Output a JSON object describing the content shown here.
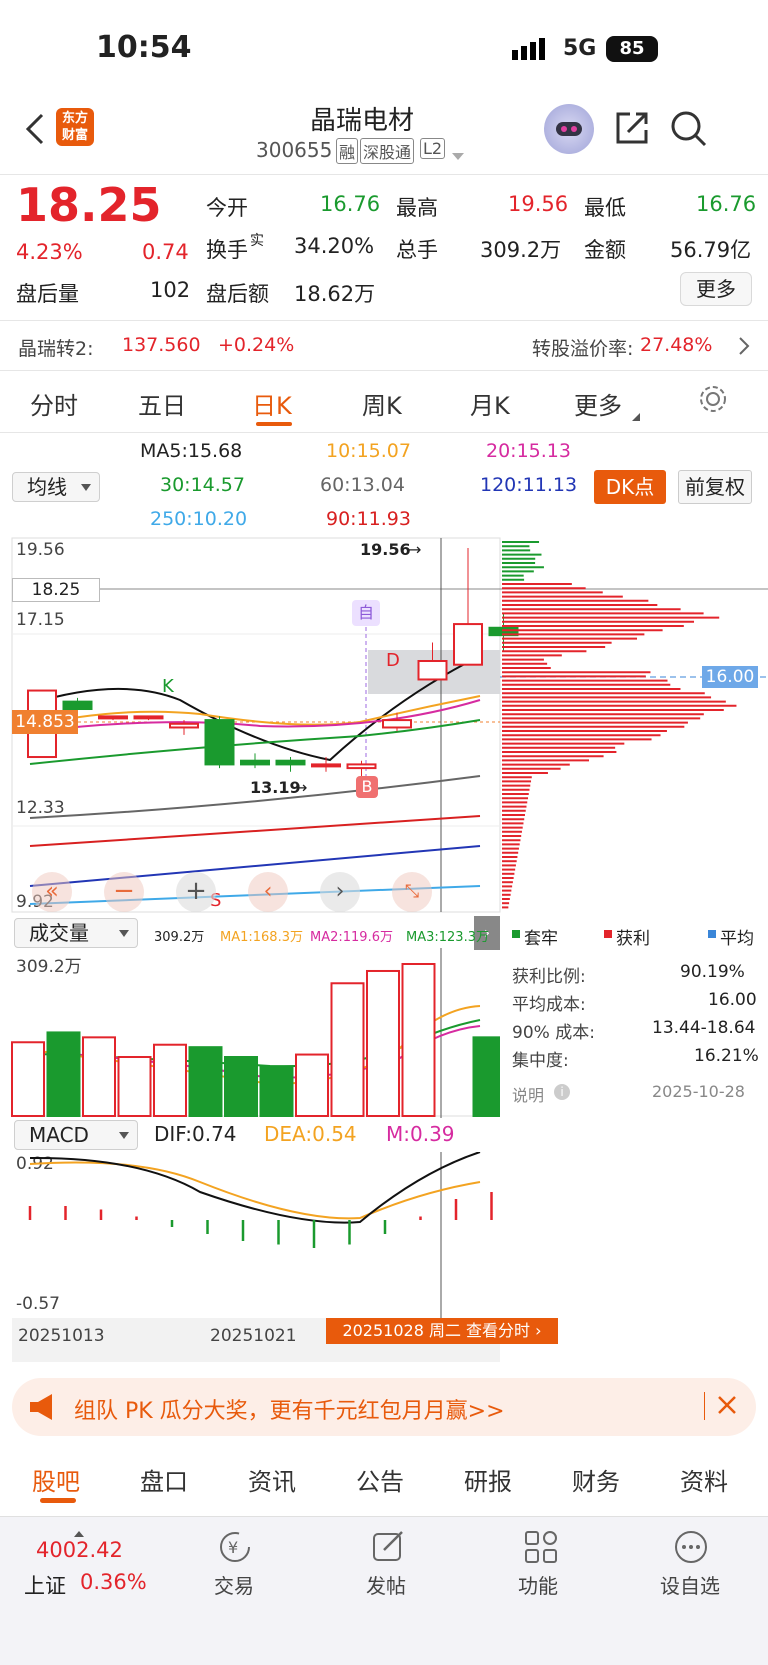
{
  "status_bar": {
    "time": "10:54",
    "network": "5G",
    "battery": "85"
  },
  "header": {
    "title": "晶瑞电材",
    "code": "300655",
    "tags": [
      "融",
      "深股通",
      "L2"
    ],
    "logo": "东方财富"
  },
  "quote": {
    "price": "18.25",
    "pct": "4.23%",
    "chg": "0.74",
    "after_vol_label": "盘后量",
    "after_vol": "102",
    "open_label": "今开",
    "open": "16.76",
    "high_label": "最高",
    "high": "19.56",
    "low_label": "最低",
    "low": "16.76",
    "turnover_label": "换手",
    "turnover_sup": "实",
    "turnover": "34.20%",
    "vol_label": "总手",
    "vol": "309.2万",
    "amount_label": "金额",
    "amount": "56.79亿",
    "after_amt_label": "盘后额",
    "after_amt": "18.62万",
    "more": "更多"
  },
  "convert": {
    "name": "晶瑞转2:",
    "price": "137.560",
    "chg": "+0.24%",
    "premium_label": "转股溢价率:",
    "premium": "27.48%"
  },
  "tabs": [
    "分时",
    "五日",
    "日K",
    "周K",
    "月K",
    "更多",
    "设置"
  ],
  "ma": {
    "select": "均线",
    "ma5": "MA5:15.68",
    "ma10": "10:15.07",
    "ma20": "20:15.13",
    "ma30": "30:14.57",
    "ma60": "60:13.04",
    "ma120": "120:11.13",
    "ma250": "250:10.20",
    "ma90": "90:11.93",
    "dk": "DK点",
    "fq": "前复权"
  },
  "kline": {
    "y1": "19.56",
    "y2": "17.15",
    "y3": "12.33",
    "y4": "9.92",
    "cur": "18.25",
    "left_price": "14.853",
    "high_tag": "19.56",
    "low_tag": "13.19",
    "chip_avg": "16.00",
    "k": "K",
    "s": "S",
    "d": "D",
    "b": "B",
    "zi": "自"
  },
  "chip": {
    "legend": [
      "套牢",
      "获利",
      "平均"
    ],
    "profit_label": "获利比例:",
    "profit": "90.19%",
    "avg_label": "平均成本:",
    "avg": "16.00",
    "c90_label": "90% 成本:",
    "c90": "13.44-18.64",
    "conc_label": "集中度:",
    "conc": "16.21%",
    "note": "说明",
    "date": "2025-10-28"
  },
  "volume": {
    "select": "成交量",
    "v": "309.2万",
    "ma1": "MA1:168.3万",
    "ma2": "MA2:119.6万",
    "ma3": "MA3:123.3万",
    "ymax": "309.2万"
  },
  "macd": {
    "select": "MACD",
    "dif": "DIF:0.74",
    "dea": "DEA:0.54",
    "m": "M:0.39",
    "ymax": "0.92",
    "ymin": "-0.57"
  },
  "dates": [
    "20251013",
    "20251021"
  ],
  "cursor_tag": "20251028 周二 查看分时",
  "banner": "组队 PK 瓜分大奖，更有千元红包月月赢>>",
  "bottom_tabs": [
    "股吧",
    "盘口",
    "资讯",
    "公告",
    "研报",
    "财务",
    "资料"
  ],
  "index": {
    "value": "4002.42",
    "name": "上证",
    "pct": "0.36%"
  },
  "actions": [
    "交易",
    "发帖",
    "功能",
    "设自选"
  ],
  "colors": {
    "up": "#e3242b",
    "down": "#1a9a2e",
    "accent": "#e85a0c"
  },
  "chart_data": {
    "type": "candlestick",
    "candles": [
      {
        "o": 13.9,
        "h": 15.7,
        "l": 13.9,
        "c": 15.7
      },
      {
        "o": 15.4,
        "h": 15.5,
        "l": 15.2,
        "c": 15.2
      },
      {
        "o": 15.0,
        "h": 15.0,
        "l": 14.9,
        "c": 15.0
      },
      {
        "o": 15.0,
        "h": 15.0,
        "l": 14.9,
        "c": 15.0
      },
      {
        "o": 14.7,
        "h": 14.9,
        "l": 14.5,
        "c": 14.8
      },
      {
        "o": 14.9,
        "h": 15.0,
        "l": 13.6,
        "c": 13.7
      },
      {
        "o": 13.8,
        "h": 14.0,
        "l": 13.6,
        "c": 13.7
      },
      {
        "o": 13.8,
        "h": 13.9,
        "l": 13.5,
        "c": 13.7
      },
      {
        "o": 13.7,
        "h": 13.9,
        "l": 13.5,
        "c": 13.7
      },
      {
        "o": 13.6,
        "h": 13.8,
        "l": 13.19,
        "c": 13.7
      },
      {
        "o": 14.7,
        "h": 15.1,
        "l": 14.6,
        "c": 14.9
      },
      {
        "o": 16.0,
        "h": 17.0,
        "l": 16.0,
        "c": 16.5
      },
      {
        "o": 16.4,
        "h": 19.56,
        "l": 16.4,
        "c": 17.5
      },
      {
        "o": 17.4,
        "h": 17.8,
        "l": 16.76,
        "c": 17.2
      }
    ],
    "volumes": [
      150,
      170,
      160,
      120,
      145,
      140,
      120,
      100,
      125,
      270,
      295,
      309.2,
      0,
      160
    ],
    "macd_m": [
      0.2,
      0.2,
      0.15,
      0.05,
      -0.1,
      -0.2,
      -0.3,
      -0.35,
      -0.4,
      -0.35,
      -0.2,
      0.05,
      0.3,
      0.4
    ]
  }
}
